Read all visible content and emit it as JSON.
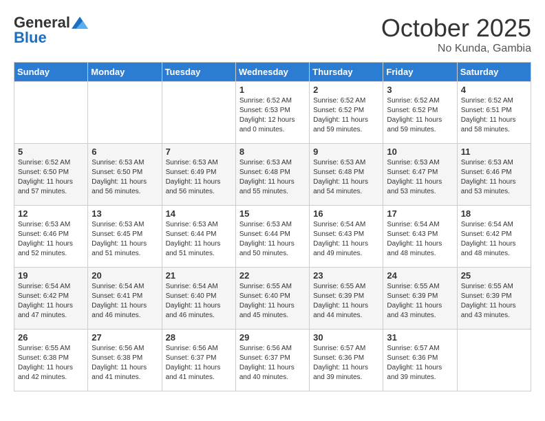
{
  "header": {
    "logo_general": "General",
    "logo_blue": "Blue",
    "month_title": "October 2025",
    "location": "No Kunda, Gambia"
  },
  "weekdays": [
    "Sunday",
    "Monday",
    "Tuesday",
    "Wednesday",
    "Thursday",
    "Friday",
    "Saturday"
  ],
  "rows": [
    [
      {
        "day": "",
        "sunrise": "",
        "sunset": "",
        "daylight": ""
      },
      {
        "day": "",
        "sunrise": "",
        "sunset": "",
        "daylight": ""
      },
      {
        "day": "",
        "sunrise": "",
        "sunset": "",
        "daylight": ""
      },
      {
        "day": "1",
        "sunrise": "Sunrise: 6:52 AM",
        "sunset": "Sunset: 6:53 PM",
        "daylight": "Daylight: 12 hours and 0 minutes."
      },
      {
        "day": "2",
        "sunrise": "Sunrise: 6:52 AM",
        "sunset": "Sunset: 6:52 PM",
        "daylight": "Daylight: 11 hours and 59 minutes."
      },
      {
        "day": "3",
        "sunrise": "Sunrise: 6:52 AM",
        "sunset": "Sunset: 6:52 PM",
        "daylight": "Daylight: 11 hours and 59 minutes."
      },
      {
        "day": "4",
        "sunrise": "Sunrise: 6:52 AM",
        "sunset": "Sunset: 6:51 PM",
        "daylight": "Daylight: 11 hours and 58 minutes."
      }
    ],
    [
      {
        "day": "5",
        "sunrise": "Sunrise: 6:52 AM",
        "sunset": "Sunset: 6:50 PM",
        "daylight": "Daylight: 11 hours and 57 minutes."
      },
      {
        "day": "6",
        "sunrise": "Sunrise: 6:53 AM",
        "sunset": "Sunset: 6:50 PM",
        "daylight": "Daylight: 11 hours and 56 minutes."
      },
      {
        "day": "7",
        "sunrise": "Sunrise: 6:53 AM",
        "sunset": "Sunset: 6:49 PM",
        "daylight": "Daylight: 11 hours and 56 minutes."
      },
      {
        "day": "8",
        "sunrise": "Sunrise: 6:53 AM",
        "sunset": "Sunset: 6:48 PM",
        "daylight": "Daylight: 11 hours and 55 minutes."
      },
      {
        "day": "9",
        "sunrise": "Sunrise: 6:53 AM",
        "sunset": "Sunset: 6:48 PM",
        "daylight": "Daylight: 11 hours and 54 minutes."
      },
      {
        "day": "10",
        "sunrise": "Sunrise: 6:53 AM",
        "sunset": "Sunset: 6:47 PM",
        "daylight": "Daylight: 11 hours and 53 minutes."
      },
      {
        "day": "11",
        "sunrise": "Sunrise: 6:53 AM",
        "sunset": "Sunset: 6:46 PM",
        "daylight": "Daylight: 11 hours and 53 minutes."
      }
    ],
    [
      {
        "day": "12",
        "sunrise": "Sunrise: 6:53 AM",
        "sunset": "Sunset: 6:46 PM",
        "daylight": "Daylight: 11 hours and 52 minutes."
      },
      {
        "day": "13",
        "sunrise": "Sunrise: 6:53 AM",
        "sunset": "Sunset: 6:45 PM",
        "daylight": "Daylight: 11 hours and 51 minutes."
      },
      {
        "day": "14",
        "sunrise": "Sunrise: 6:53 AM",
        "sunset": "Sunset: 6:44 PM",
        "daylight": "Daylight: 11 hours and 51 minutes."
      },
      {
        "day": "15",
        "sunrise": "Sunrise: 6:53 AM",
        "sunset": "Sunset: 6:44 PM",
        "daylight": "Daylight: 11 hours and 50 minutes."
      },
      {
        "day": "16",
        "sunrise": "Sunrise: 6:54 AM",
        "sunset": "Sunset: 6:43 PM",
        "daylight": "Daylight: 11 hours and 49 minutes."
      },
      {
        "day": "17",
        "sunrise": "Sunrise: 6:54 AM",
        "sunset": "Sunset: 6:43 PM",
        "daylight": "Daylight: 11 hours and 48 minutes."
      },
      {
        "day": "18",
        "sunrise": "Sunrise: 6:54 AM",
        "sunset": "Sunset: 6:42 PM",
        "daylight": "Daylight: 11 hours and 48 minutes."
      }
    ],
    [
      {
        "day": "19",
        "sunrise": "Sunrise: 6:54 AM",
        "sunset": "Sunset: 6:42 PM",
        "daylight": "Daylight: 11 hours and 47 minutes."
      },
      {
        "day": "20",
        "sunrise": "Sunrise: 6:54 AM",
        "sunset": "Sunset: 6:41 PM",
        "daylight": "Daylight: 11 hours and 46 minutes."
      },
      {
        "day": "21",
        "sunrise": "Sunrise: 6:54 AM",
        "sunset": "Sunset: 6:40 PM",
        "daylight": "Daylight: 11 hours and 46 minutes."
      },
      {
        "day": "22",
        "sunrise": "Sunrise: 6:55 AM",
        "sunset": "Sunset: 6:40 PM",
        "daylight": "Daylight: 11 hours and 45 minutes."
      },
      {
        "day": "23",
        "sunrise": "Sunrise: 6:55 AM",
        "sunset": "Sunset: 6:39 PM",
        "daylight": "Daylight: 11 hours and 44 minutes."
      },
      {
        "day": "24",
        "sunrise": "Sunrise: 6:55 AM",
        "sunset": "Sunset: 6:39 PM",
        "daylight": "Daylight: 11 hours and 43 minutes."
      },
      {
        "day": "25",
        "sunrise": "Sunrise: 6:55 AM",
        "sunset": "Sunset: 6:39 PM",
        "daylight": "Daylight: 11 hours and 43 minutes."
      }
    ],
    [
      {
        "day": "26",
        "sunrise": "Sunrise: 6:55 AM",
        "sunset": "Sunset: 6:38 PM",
        "daylight": "Daylight: 11 hours and 42 minutes."
      },
      {
        "day": "27",
        "sunrise": "Sunrise: 6:56 AM",
        "sunset": "Sunset: 6:38 PM",
        "daylight": "Daylight: 11 hours and 41 minutes."
      },
      {
        "day": "28",
        "sunrise": "Sunrise: 6:56 AM",
        "sunset": "Sunset: 6:37 PM",
        "daylight": "Daylight: 11 hours and 41 minutes."
      },
      {
        "day": "29",
        "sunrise": "Sunrise: 6:56 AM",
        "sunset": "Sunset: 6:37 PM",
        "daylight": "Daylight: 11 hours and 40 minutes."
      },
      {
        "day": "30",
        "sunrise": "Sunrise: 6:57 AM",
        "sunset": "Sunset: 6:36 PM",
        "daylight": "Daylight: 11 hours and 39 minutes."
      },
      {
        "day": "31",
        "sunrise": "Sunrise: 6:57 AM",
        "sunset": "Sunset: 6:36 PM",
        "daylight": "Daylight: 11 hours and 39 minutes."
      },
      {
        "day": "",
        "sunrise": "",
        "sunset": "",
        "daylight": ""
      }
    ]
  ]
}
